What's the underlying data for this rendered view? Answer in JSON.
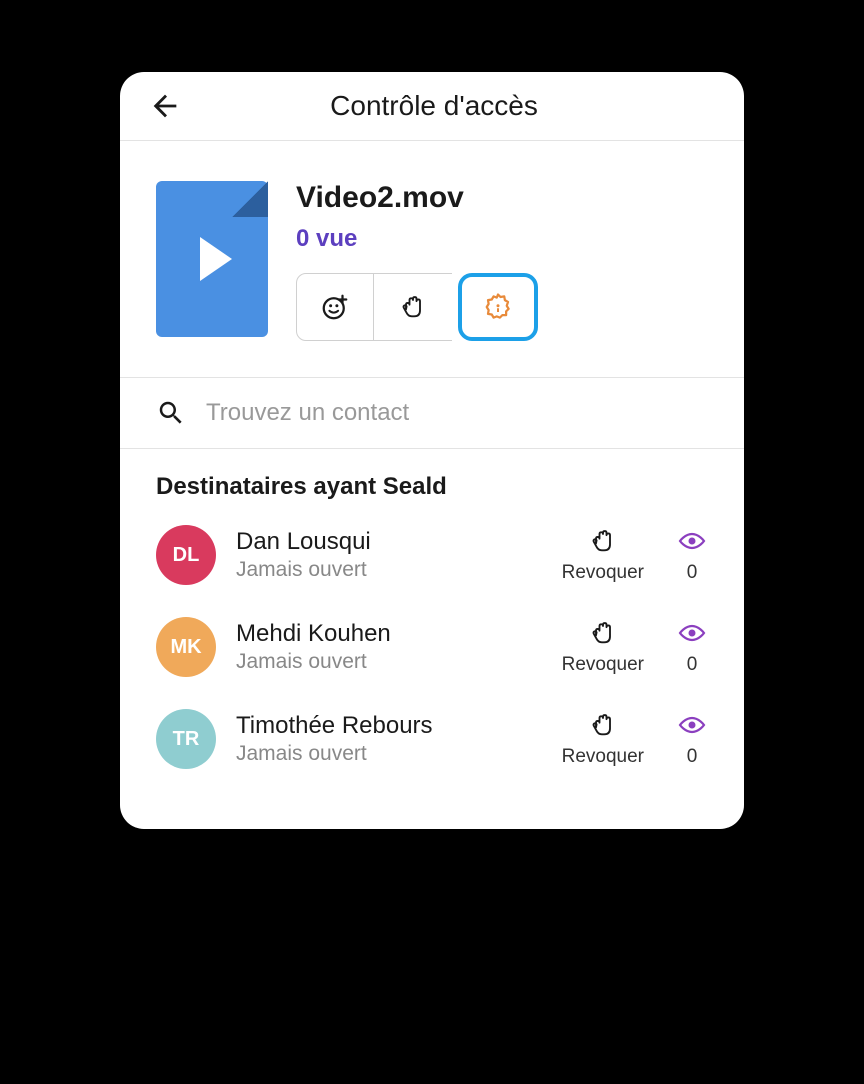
{
  "header": {
    "title": "Contrôle d'accès"
  },
  "file": {
    "name": "Video2.mov",
    "view_count": "0 vue"
  },
  "search": {
    "placeholder": "Trouvez un contact"
  },
  "section": {
    "title": "Destinataires ayant Seald"
  },
  "recipients": [
    {
      "initials": "DL",
      "name": "Dan Lousqui",
      "status": "Jamais ouvert",
      "color": "#d93a5e",
      "revoke_label": "Revoquer",
      "view_count": "0"
    },
    {
      "initials": "MK",
      "name": "Mehdi Kouhen",
      "status": "Jamais ouvert",
      "color": "#f0a95a",
      "revoke_label": "Revoquer",
      "view_count": "0"
    },
    {
      "initials": "TR",
      "name": "Timothée Rebours",
      "status": "Jamais ouvert",
      "color": "#8fcdd0",
      "revoke_label": "Revoquer",
      "view_count": "0"
    }
  ]
}
